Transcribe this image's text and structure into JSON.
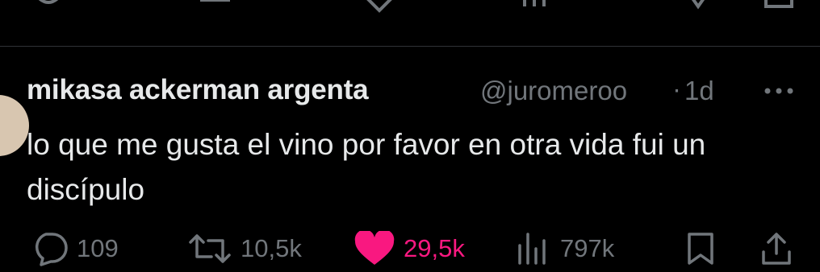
{
  "tweet": {
    "display_name": "mikasa ackerman argenta",
    "handle": "@juromeroo",
    "separator": "·",
    "time": "1d",
    "text": "lo que me gusta el vino por favor en otra vida fui un discípulo"
  },
  "actions": {
    "reply": {
      "icon": "reply-icon",
      "count": "109"
    },
    "retweet": {
      "icon": "retweet-icon",
      "count": "10,5k"
    },
    "like": {
      "icon": "heart-icon",
      "count": "29,5k",
      "active": true,
      "color": "#f91880"
    },
    "views": {
      "icon": "views-icon",
      "count": "797k"
    },
    "bookmark": {
      "icon": "bookmark-icon"
    },
    "share": {
      "icon": "share-icon"
    }
  },
  "colors": {
    "background": "#000000",
    "primary_text": "#e7e9ea",
    "secondary_text": "#71767b",
    "like": "#f91880"
  }
}
